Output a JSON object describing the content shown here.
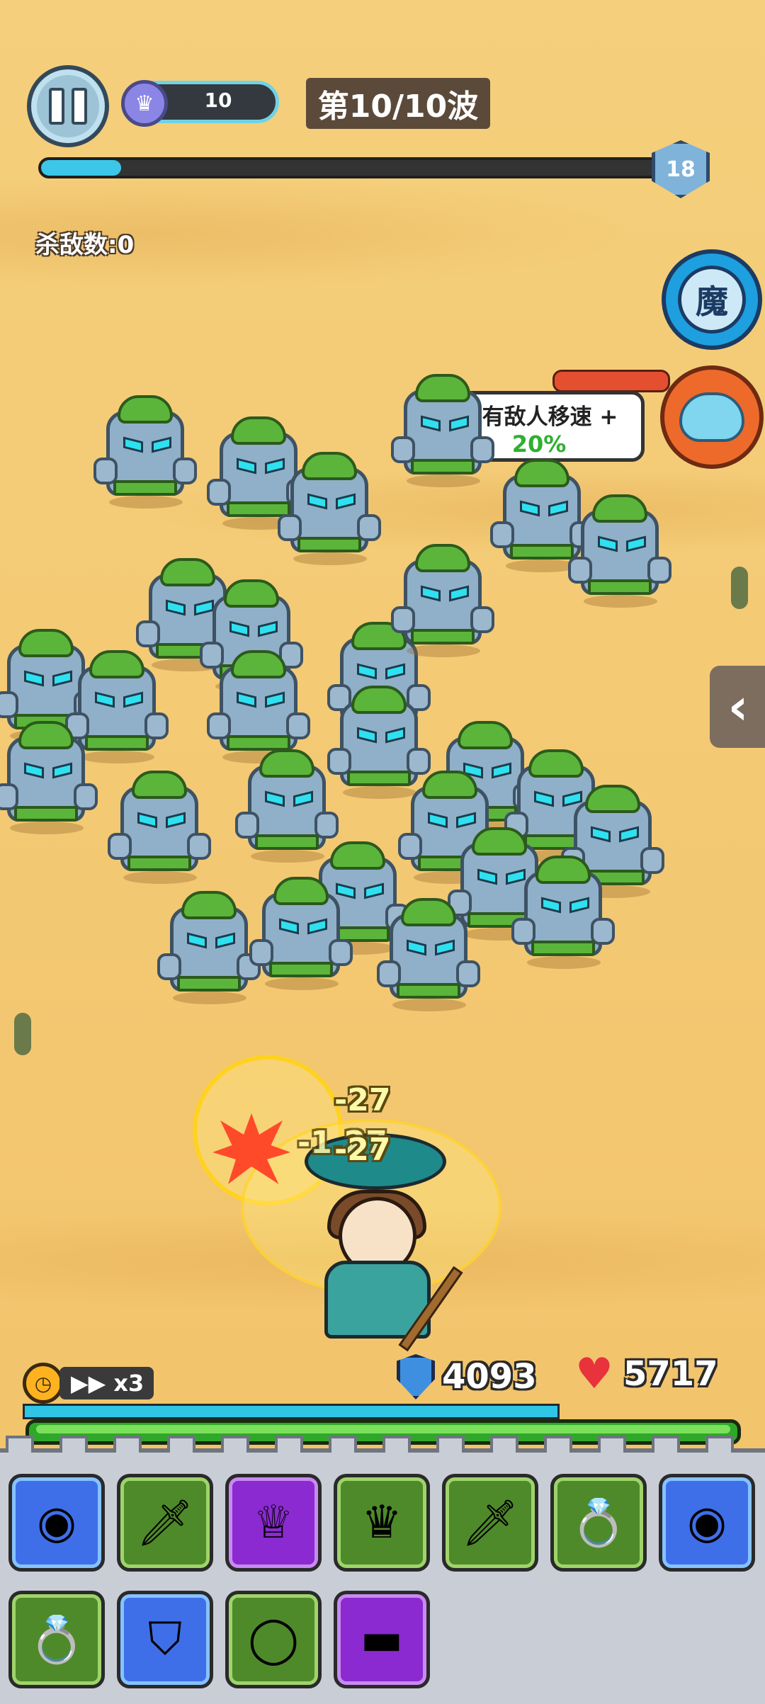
{
  "hud": {
    "xp_value": "10",
    "wave_label": "第10/10波",
    "level": "18",
    "wave_progress": 0.13,
    "kills_label": "杀敌数:0",
    "magic_label": "魔"
  },
  "notification": {
    "line1": "所有敌人移速 +",
    "line2": "20%"
  },
  "combat": {
    "damage_numbers": [
      "-27",
      "-1.27",
      "-27"
    ]
  },
  "stats": {
    "speed_label": "x3",
    "shield": "4093",
    "health": "5717",
    "shield_fraction": 0.69,
    "health_fraction": 1.0
  },
  "inventory": {
    "row1": [
      {
        "name": "donut-relic",
        "rarity": "blue",
        "glyph": "◉"
      },
      {
        "name": "iron-sword",
        "rarity": "green",
        "glyph": "🗡"
      },
      {
        "name": "jeweled-tiara",
        "rarity": "purple",
        "glyph": "♕"
      },
      {
        "name": "ruby-crown",
        "rarity": "green",
        "glyph": "♛"
      },
      {
        "name": "bronze-sword",
        "rarity": "green",
        "glyph": "🗡"
      },
      {
        "name": "gem-ring",
        "rarity": "green",
        "glyph": "💍"
      },
      {
        "name": "donut-relic",
        "rarity": "blue",
        "glyph": "◉"
      }
    ],
    "row2": [
      {
        "name": "gem-ring",
        "rarity": "green",
        "glyph": "💍"
      },
      {
        "name": "wooden-shield",
        "rarity": "blue",
        "glyph": "⛉"
      },
      {
        "name": "bronze-ring",
        "rarity": "green",
        "glyph": "◯"
      },
      {
        "name": "leather-belt",
        "rarity": "purple",
        "glyph": "▬"
      }
    ]
  },
  "colors": {
    "sand": "#f2c46c",
    "xp_bar": "#3cc7e8",
    "health_bar": "#2fa82a",
    "shield_bar": "#2fc6e6",
    "notification_green": "#2fb030"
  }
}
